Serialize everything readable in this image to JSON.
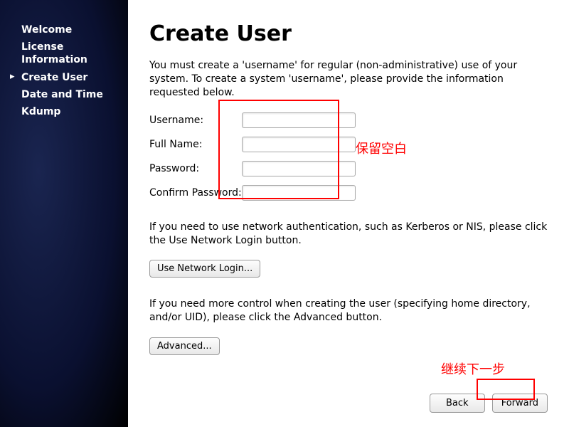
{
  "sidebar": {
    "items": [
      {
        "label": "Welcome",
        "active": false
      },
      {
        "label": "License Information",
        "active": false
      },
      {
        "label": "Create User",
        "active": true
      },
      {
        "label": "Date and Time",
        "active": false
      },
      {
        "label": "Kdump",
        "active": false
      }
    ]
  },
  "main": {
    "title": "Create User",
    "intro": "You must create a 'username' for regular (non-administrative) use of your system.  To create a system 'username', please provide the information requested below.",
    "form": {
      "username_label": "Username:",
      "username_value": "",
      "fullname_label": "Full Name:",
      "fullname_value": "",
      "password_label": "Password:",
      "password_value": "",
      "confirm_label": "Confirm Password:",
      "confirm_value": ""
    },
    "network_help": "If you need to use network authentication, such as Kerberos or NIS, please click the Use Network Login button.",
    "network_button": "Use Network Login...",
    "advanced_help": "If you need more control when creating the user (specifying home directory, and/or UID), please click the Advanced button.",
    "advanced_button": "Advanced...",
    "back_button": "Back",
    "forward_button": "Forward"
  },
  "annotations": {
    "keep_blank": "保留空白",
    "continue_next": "继续下一步"
  }
}
